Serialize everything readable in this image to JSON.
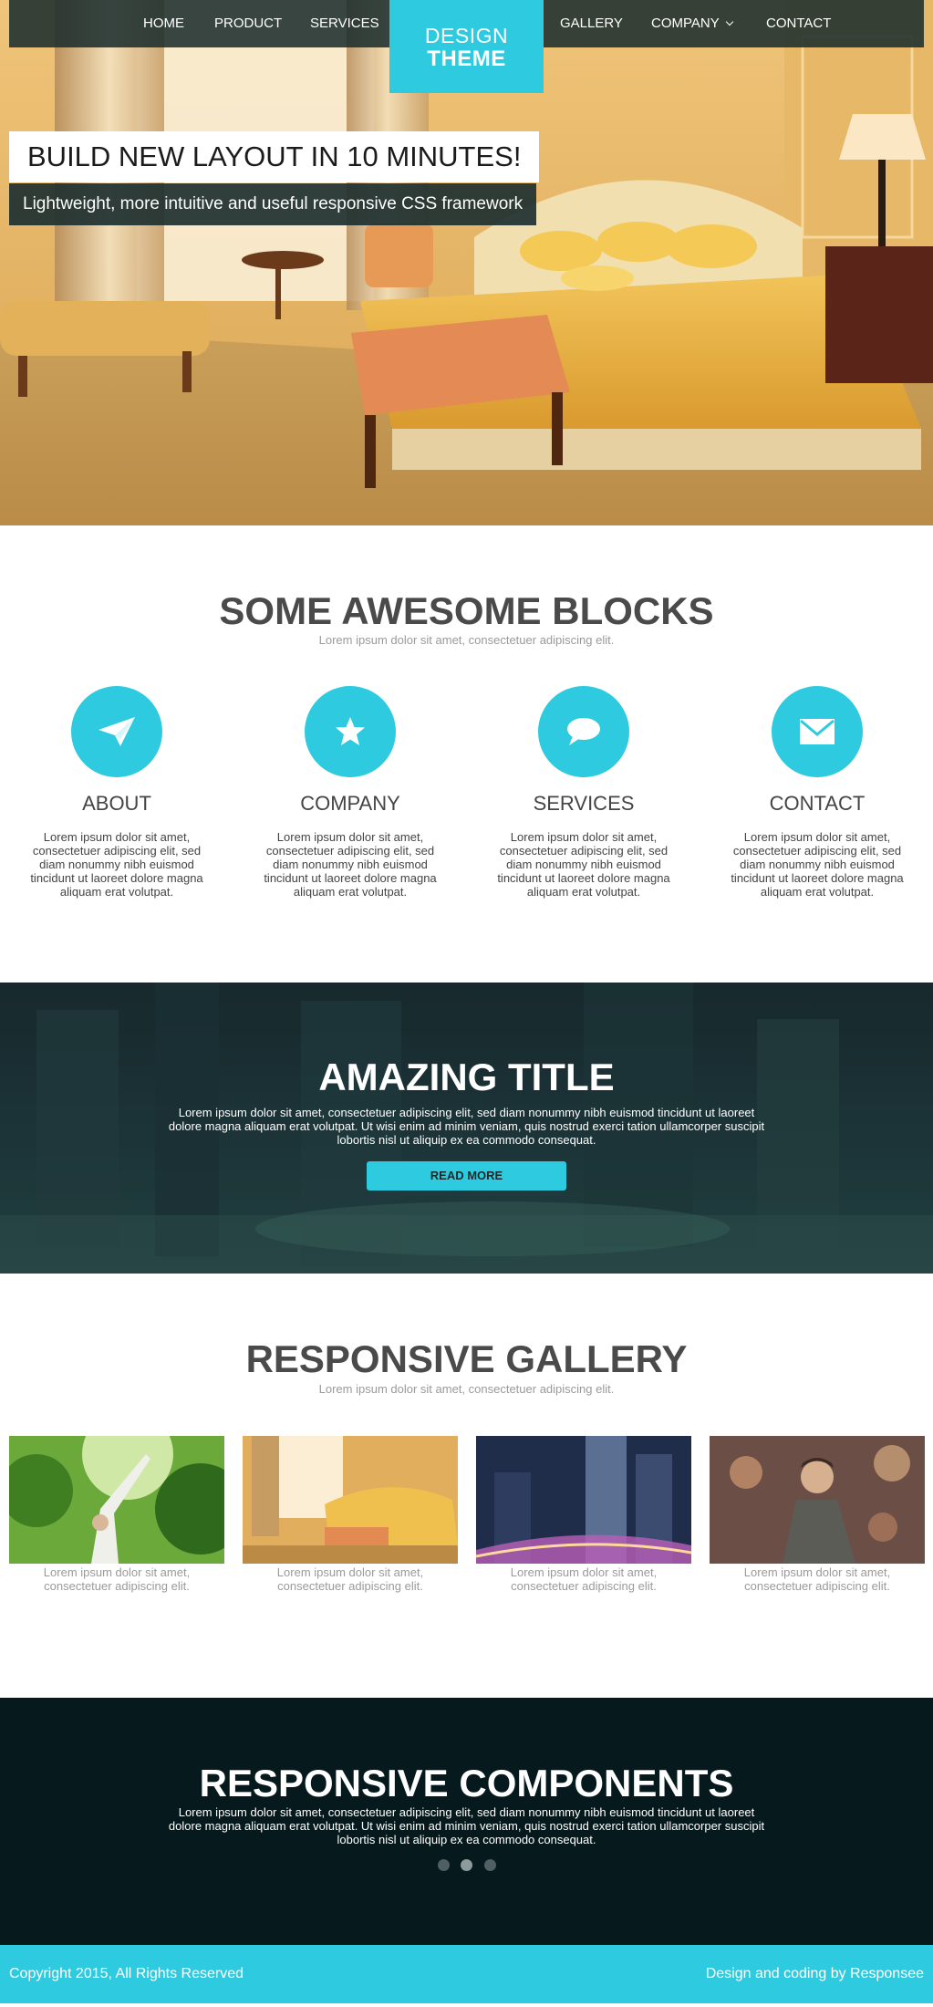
{
  "nav": {
    "items": [
      "HOME",
      "PRODUCT",
      "SERVICES",
      "GALLERY",
      "COMPANY",
      "CONTACT"
    ],
    "logo_top": "DESIGN",
    "logo_bottom": "THEME"
  },
  "hero": {
    "title": "BUILD NEW LAYOUT IN 10 MINUTES!",
    "subtitle": "Lightweight, more intuitive and useful responsive CSS framework"
  },
  "blocks": {
    "title": "SOME AWESOME BLOCKS",
    "subtitle": "Lorem ipsum dolor sit amet, consectetuer adipiscing elit.",
    "items": [
      {
        "icon": "paper-plane-icon",
        "title": "ABOUT",
        "text": "Lorem ipsum dolor sit amet, consectetuer adipiscing elit, sed diam nonummy nibh euismod tincidunt ut laoreet dolore magna aliquam erat volutpat."
      },
      {
        "icon": "star-icon",
        "title": "COMPANY",
        "text": "Lorem ipsum dolor sit amet, consectetuer adipiscing elit, sed diam nonummy nibh euismod tincidunt ut laoreet dolore magna aliquam erat volutpat."
      },
      {
        "icon": "speech-bubble-icon",
        "title": "SERVICES",
        "text": "Lorem ipsum dolor sit amet, consectetuer adipiscing elit, sed diam nonummy nibh euismod tincidunt ut laoreet dolore magna aliquam erat volutpat."
      },
      {
        "icon": "envelope-icon",
        "title": "CONTACT",
        "text": "Lorem ipsum dolor sit amet, consectetuer adipiscing elit, sed diam nonummy nibh euismod tincidunt ut laoreet dolore magna aliquam erat volutpat."
      }
    ]
  },
  "amazing": {
    "title": "AMAZING TITLE",
    "text": "Lorem ipsum dolor sit amet, consectetuer adipiscing elit, sed diam nonummy nibh euismod tincidunt ut laoreet dolore magna aliquam erat volutpat. Ut wisi enim ad minim veniam, quis nostrud exerci tation ullamcorper suscipit lobortis nisl ut aliquip ex ea commodo consequat.",
    "button": "READ MORE"
  },
  "gallery": {
    "title": "RESPONSIVE GALLERY",
    "subtitle": "Lorem ipsum dolor sit amet, consectetuer adipiscing elit.",
    "items": [
      {
        "caption": "Lorem ipsum dolor sit amet, consectetuer adipiscing elit."
      },
      {
        "caption": "Lorem ipsum dolor sit amet, consectetuer adipiscing elit."
      },
      {
        "caption": "Lorem ipsum dolor sit amet, consectetuer adipiscing elit."
      },
      {
        "caption": "Lorem ipsum dolor sit amet, consectetuer adipiscing elit."
      }
    ]
  },
  "components": {
    "title": "RESPONSIVE COMPONENTS",
    "text": "Lorem ipsum dolor sit amet, consectetuer adipiscing elit, sed diam nonummy nibh euismod tincidunt ut laoreet dolore magna aliquam erat volutpat. Ut wisi enim ad minim veniam, quis nostrud exerci tation ullamcorper suscipit lobortis nisl ut aliquip ex ea commodo consequat.",
    "active_dot": 2
  },
  "footer": {
    "left": "Copyright 2015, All Rights Reserved",
    "right": "Design and coding by Responsee"
  },
  "colors": {
    "accent": "#2ecbe0",
    "nav_bg": "#1c2d2d",
    "dark_section": "#061a1d",
    "text": "#444444",
    "muted": "#9a9a9a"
  }
}
